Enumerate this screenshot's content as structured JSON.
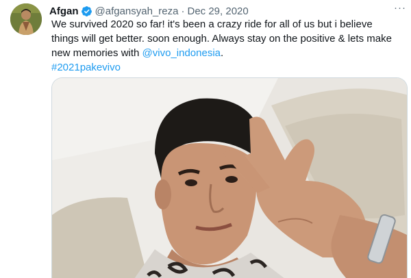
{
  "tweet": {
    "author_name": "Afgan",
    "handle": "@afgansyah_reza",
    "separator": "·",
    "date": "Dec 29, 2020",
    "more_label": "···",
    "text_line1": "We survived 2020 so far! it's been a crazy ride for all of us but i believe",
    "text_line2_a": "things will get better. soon enough. Always stay on the positive & lets make",
    "text_line3_a": "new memories with ",
    "mention": "@vivo_indonesia",
    "text_line3_b": ".",
    "hashtag": "#2021pakevivo",
    "verified": true
  },
  "icons": {
    "verified": "verified-badge-icon",
    "more": "more-options-icon"
  },
  "colors": {
    "link": "#1d9bf0",
    "secondary_text": "#536471",
    "primary_text": "#0f1419",
    "border": "#cfd9de"
  }
}
